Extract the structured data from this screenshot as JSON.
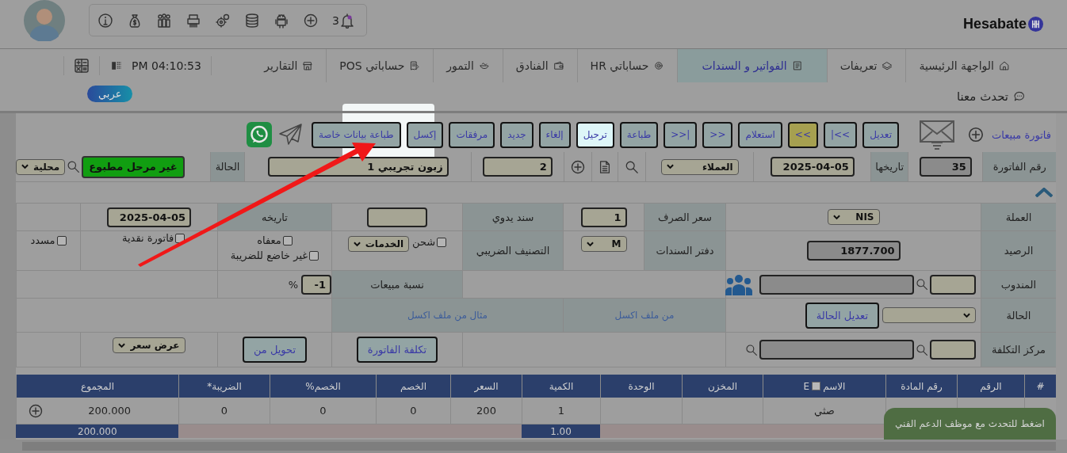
{
  "header": {
    "logo": "Hesabate",
    "notification_count": "3"
  },
  "nav": {
    "tabs": [
      {
        "label": "الواجهة الرئيسية",
        "selected": false
      },
      {
        "label": "تعريفات",
        "selected": false
      },
      {
        "label": "الفواتير و السندات",
        "selected": true
      },
      {
        "label": "حساباتي HR",
        "selected": false
      },
      {
        "label": "الفنادق",
        "selected": false
      },
      {
        "label": "التمور",
        "selected": false
      },
      {
        "label": "حساباتي POS",
        "selected": false
      },
      {
        "label": "التقارير",
        "selected": false
      }
    ],
    "clock": "PM 04:10:53",
    "chat": "تحدث معنا",
    "language": "عربي"
  },
  "toolbar": {
    "title": "فاتورة مبيعات",
    "buttons": [
      {
        "label": "تعديل",
        "kind": "plain"
      },
      {
        "label": "|<<",
        "kind": "plain"
      },
      {
        "label": "<<",
        "kind": "current"
      },
      {
        "label": "استعلام",
        "kind": "plain"
      },
      {
        "label": ">>",
        "kind": "plain"
      },
      {
        "label": ">>|",
        "kind": "plain"
      },
      {
        "label": "طباعة",
        "kind": "plain"
      },
      {
        "label": "ترحيل",
        "kind": "spotlight"
      },
      {
        "label": "إلغاء",
        "kind": "plain"
      },
      {
        "label": "جديد",
        "kind": "plain"
      },
      {
        "label": "مرفقات",
        "kind": "plain"
      },
      {
        "label": "إكسل",
        "kind": "plain"
      },
      {
        "label": "طباعة بيانات خاصة",
        "kind": "plain"
      }
    ]
  },
  "invoice": {
    "number_label": "رقم الفاتورة",
    "number": "35",
    "date_label": "تاريخها",
    "date": "2025-04-05",
    "party": "العملاء",
    "account_no": "2",
    "customer": "زبون تجريبي 1",
    "status_label": "الحالة",
    "status": "غير مرحل مطبوع",
    "scope": "محلية"
  },
  "form": {
    "currency_label": "العملة",
    "currency": "NIS",
    "rate_label": "سعر الصرف",
    "rate": "1",
    "manual_label": "سند يدوي",
    "date_label": "تاريخه",
    "date": "2025-04-05",
    "balance_label": "الرصيد",
    "balance": "1877.700",
    "book_label": "دفتر السندات",
    "book": "M",
    "tax_label": "التصنيف الضريبي",
    "tax_class": "الخدمات",
    "checkboxes": [
      {
        "label": "شحن",
        "checked": false
      },
      {
        "label": "معفاه",
        "checked": false
      },
      {
        "label": "غير خاضع للضريبة",
        "checked": false
      },
      {
        "label": "فاتورة نقدية",
        "checked": false
      },
      {
        "label": "مسدد",
        "checked": false
      }
    ],
    "rep_label": "المندوب",
    "sales_pct_label": "نسبة مبيعات",
    "sales_pct": "-1",
    "pct_sign": "%",
    "status_label": "الحالة",
    "edit_status": "تعديل الحالة",
    "excel_import": "من ملف اكسل",
    "excel_sample": "مثال من ملف اكسل",
    "cost_label": "مركز التكلفة",
    "invoice_cost": "تكلفة الفاتورة",
    "convert_from": "تحويل من",
    "quote": "عرض سعر"
  },
  "table": {
    "columns": [
      {
        "label": "#"
      },
      {
        "label": "الرقم"
      },
      {
        "label": "رقم المادة"
      },
      {
        "label": "الاسم",
        "extra": "E"
      },
      {
        "label": "المخزن"
      },
      {
        "label": "الوحدة"
      },
      {
        "label": "الكمية"
      },
      {
        "label": "السعر"
      },
      {
        "label": "الخصم"
      },
      {
        "label": "الخصم%"
      },
      {
        "label": "الضريبة*"
      },
      {
        "label": "المجموع"
      }
    ],
    "rows": [
      {
        "cells": [
          "",
          "",
          "",
          "صثي",
          "",
          "",
          "1",
          "200",
          "0",
          "0",
          "0",
          "200.000"
        ]
      }
    ],
    "totals": {
      "quantity": "1.00",
      "total": "200.000"
    }
  },
  "support_toast": "اضغط للتحدث مع موظف الدعم الفني"
}
